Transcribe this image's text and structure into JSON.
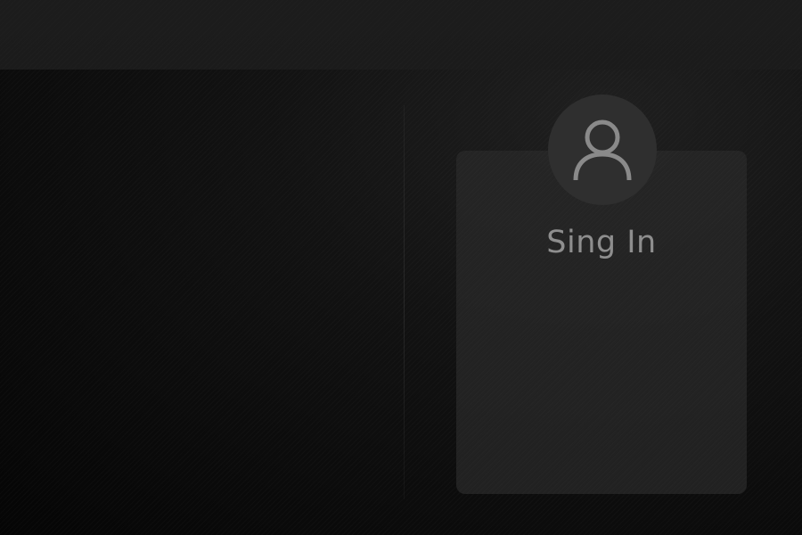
{
  "signin": {
    "label": "Sing In",
    "avatar_icon": "user-icon"
  },
  "colors": {
    "background": "#0a0a0a",
    "top_bar": "#1c1c1c",
    "panel": "#282828",
    "avatar": "#2f2f2f",
    "text": "#8e8e8e"
  }
}
